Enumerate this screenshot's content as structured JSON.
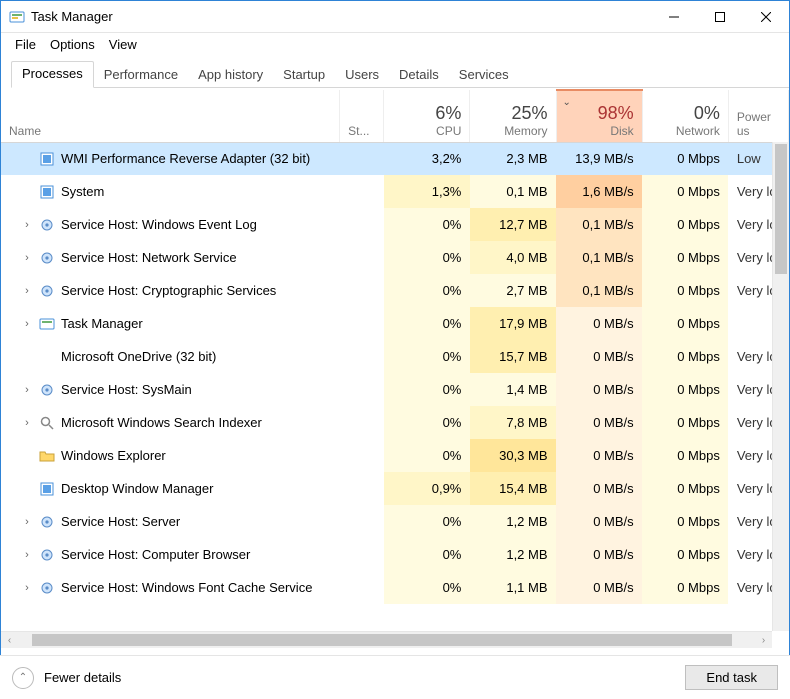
{
  "titlebar": {
    "title": "Task Manager"
  },
  "menu": {
    "file": "File",
    "options": "Options",
    "view": "View"
  },
  "tabs": {
    "processes": "Processes",
    "performance": "Performance",
    "app_history": "App history",
    "startup": "Startup",
    "users": "Users",
    "details": "Details",
    "services": "Services"
  },
  "headers": {
    "name": "Name",
    "status": "St...",
    "cpu_pct": "6%",
    "cpu": "CPU",
    "mem_pct": "25%",
    "memory": "Memory",
    "disk_pct": "98%",
    "disk": "Disk",
    "net_pct": "0%",
    "network": "Network",
    "power": "Power us"
  },
  "footer": {
    "fewer": "Fewer details",
    "end_task": "End task"
  },
  "rows": [
    {
      "exp": "",
      "icon": "app",
      "name": "WMI Performance Reverse Adapter (32 bit)",
      "cpu": "3,2%",
      "mem": "2,3 MB",
      "disk": "13,9 MB/s",
      "net": "0 Mbps",
      "pwr": "Low",
      "selected": true,
      "disk_heat": 3
    },
    {
      "exp": "",
      "icon": "app",
      "name": "System",
      "cpu": "1,3%",
      "mem": "0,1 MB",
      "disk": "1,6 MB/s",
      "net": "0 Mbps",
      "pwr": "Very lo",
      "disk_heat": 2
    },
    {
      "exp": "›",
      "icon": "gear",
      "name": "Service Host: Windows Event Log",
      "cpu": "0%",
      "mem": "12,7 MB",
      "disk": "0,1 MB/s",
      "net": "0 Mbps",
      "pwr": "Very lo",
      "disk_heat": 1
    },
    {
      "exp": "›",
      "icon": "gear",
      "name": "Service Host: Network Service",
      "cpu": "0%",
      "mem": "4,0 MB",
      "disk": "0,1 MB/s",
      "net": "0 Mbps",
      "pwr": "Very lo",
      "disk_heat": 1
    },
    {
      "exp": "›",
      "icon": "gear",
      "name": "Service Host: Cryptographic Services",
      "cpu": "0%",
      "mem": "2,7 MB",
      "disk": "0,1 MB/s",
      "net": "0 Mbps",
      "pwr": "Very lo",
      "disk_heat": 1
    },
    {
      "exp": "›",
      "icon": "tm",
      "name": "Task Manager",
      "cpu": "0%",
      "mem": "17,9 MB",
      "disk": "0 MB/s",
      "net": "0 Mbps",
      "pwr": "",
      "disk_heat": 0
    },
    {
      "exp": "",
      "icon": "blank",
      "name": "Microsoft OneDrive (32 bit)",
      "cpu": "0%",
      "mem": "15,7 MB",
      "disk": "0 MB/s",
      "net": "0 Mbps",
      "pwr": "Very lo",
      "disk_heat": 0
    },
    {
      "exp": "›",
      "icon": "gear",
      "name": "Service Host: SysMain",
      "cpu": "0%",
      "mem": "1,4 MB",
      "disk": "0 MB/s",
      "net": "0 Mbps",
      "pwr": "Very lo",
      "disk_heat": 0
    },
    {
      "exp": "›",
      "icon": "search",
      "name": "Microsoft Windows Search Indexer",
      "cpu": "0%",
      "mem": "7,8 MB",
      "disk": "0 MB/s",
      "net": "0 Mbps",
      "pwr": "Very lo",
      "disk_heat": 0
    },
    {
      "exp": "",
      "icon": "folder",
      "name": "Windows Explorer",
      "cpu": "0%",
      "mem": "30,3 MB",
      "disk": "0 MB/s",
      "net": "0 Mbps",
      "pwr": "Very lo",
      "disk_heat": 0
    },
    {
      "exp": "",
      "icon": "app",
      "name": "Desktop Window Manager",
      "cpu": "0,9%",
      "mem": "15,4 MB",
      "disk": "0 MB/s",
      "net": "0 Mbps",
      "pwr": "Very lo",
      "disk_heat": 0
    },
    {
      "exp": "›",
      "icon": "gear",
      "name": "Service Host: Server",
      "cpu": "0%",
      "mem": "1,2 MB",
      "disk": "0 MB/s",
      "net": "0 Mbps",
      "pwr": "Very lo",
      "disk_heat": 0
    },
    {
      "exp": "›",
      "icon": "gear",
      "name": "Service Host: Computer Browser",
      "cpu": "0%",
      "mem": "1,2 MB",
      "disk": "0 MB/s",
      "net": "0 Mbps",
      "pwr": "Very lo",
      "disk_heat": 0
    },
    {
      "exp": "›",
      "icon": "gear",
      "name": "Service Host: Windows Font Cache Service",
      "cpu": "0%",
      "mem": "1,1 MB",
      "disk": "0 MB/s",
      "net": "0 Mbps",
      "pwr": "Very lo",
      "disk_heat": 0
    }
  ]
}
